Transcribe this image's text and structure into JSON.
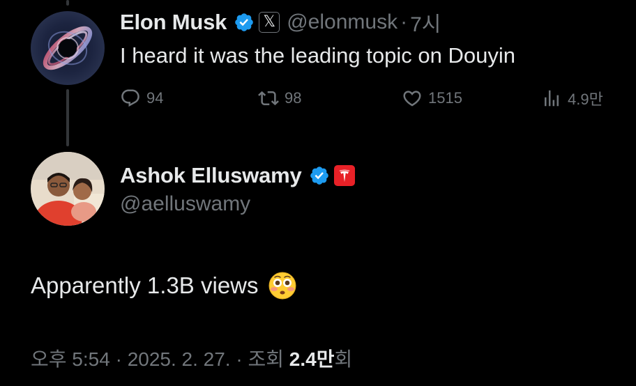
{
  "parent_tweet": {
    "display_name": "Elon Musk",
    "affiliation_badge": "𝕏",
    "handle": "@elonmusk",
    "separator": "·",
    "time_ago": "7시",
    "text": "I heard it was the leading topic on Douyin",
    "replies": "94",
    "retweets": "98",
    "likes": "1515",
    "views": "4.9만"
  },
  "reply_tweet": {
    "display_name": "Ashok Elluswamy",
    "handle": "@aelluswamy",
    "text": "Apparently 1.3B views",
    "emoji": "😳",
    "time": "오후 5:54",
    "date": "2025. 2. 27.",
    "views_label": "조회",
    "views_count": "2.4만",
    "views_suffix": "회",
    "meta_separator": "·"
  },
  "colors": {
    "background": "#000000",
    "primary_text": "#e7e9ea",
    "secondary_text": "#71767b",
    "verified_blue": "#1d9bf0",
    "tesla_red": "#e82127",
    "thread_line": "#333639"
  },
  "icons": {
    "verified": "verified-badge-icon",
    "x_affiliation": "x-logo-icon",
    "tesla_affiliation": "tesla-logo-icon",
    "reply": "reply-icon",
    "retweet": "retweet-icon",
    "like": "heart-icon",
    "views": "views-chart-icon"
  }
}
